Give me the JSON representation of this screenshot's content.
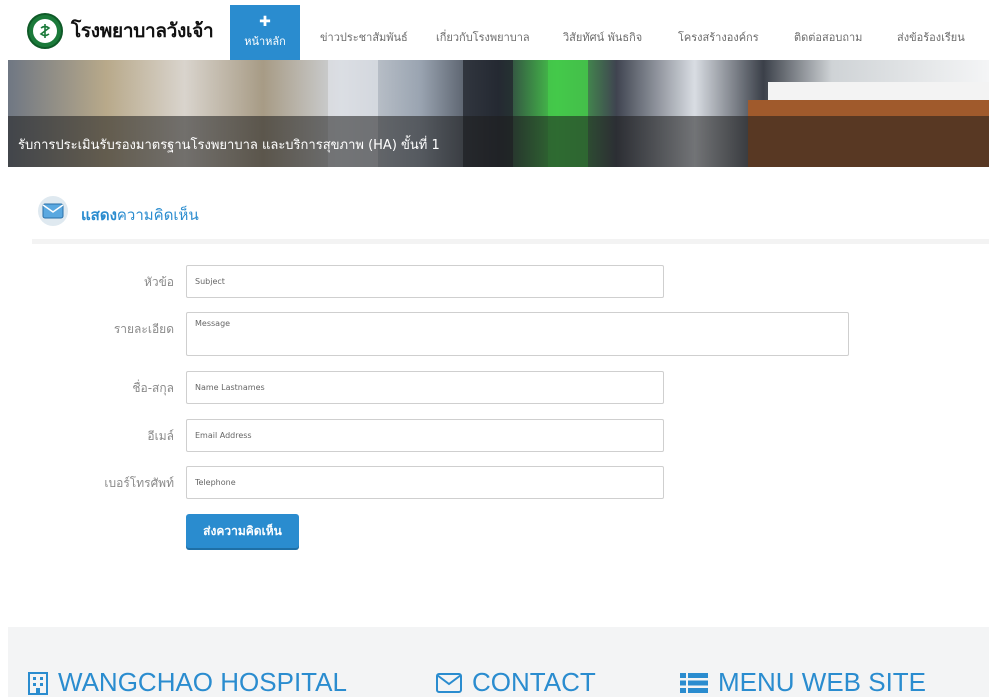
{
  "brand": {
    "name": "โรงพยาบาลวังเจ้า"
  },
  "nav": {
    "home": {
      "icon": "plus-icon",
      "label": "หน้าหลัก"
    },
    "items": [
      "ข่าวประชาสัมพันธ์",
      "เกี่ยวกับโรงพยาบาล",
      "วิสัยทัศน์ พันธกิจ",
      "โครงสร้างองค์กร",
      "ติดต่อสอบถาม",
      "ส่งข้อร้องเรียน"
    ]
  },
  "banner": {
    "caption": "รับการประเมินรับรองมาตรฐานโรงพยาบาล และบริการสุขภาพ (HA) ขั้นที่ 1"
  },
  "section": {
    "icon": "mail-icon",
    "title_bold": "แสดง",
    "title_rest": "ความคิดเห็น"
  },
  "form": {
    "subject": {
      "label": "หัวข้อ",
      "placeholder": "Subject"
    },
    "message": {
      "label": "รายละเอียด",
      "placeholder": "Message"
    },
    "name": {
      "label": "ชื่อ-สกุล",
      "placeholder": "Name Lastnames"
    },
    "email": {
      "label": "อีเมล์",
      "placeholder": "Email Address"
    },
    "phone": {
      "label": "เบอร์โทรศัพท์",
      "placeholder": "Telephone"
    },
    "submit_label": "ส่งความคิดเห็น"
  },
  "footer": {
    "hospital": "WANGCHAO HOSPITAL",
    "contact": "CONTACT",
    "menu": "MENU WEB SITE"
  },
  "colors": {
    "accent": "#2a8ccf",
    "logo_green": "#1b7a3a"
  }
}
